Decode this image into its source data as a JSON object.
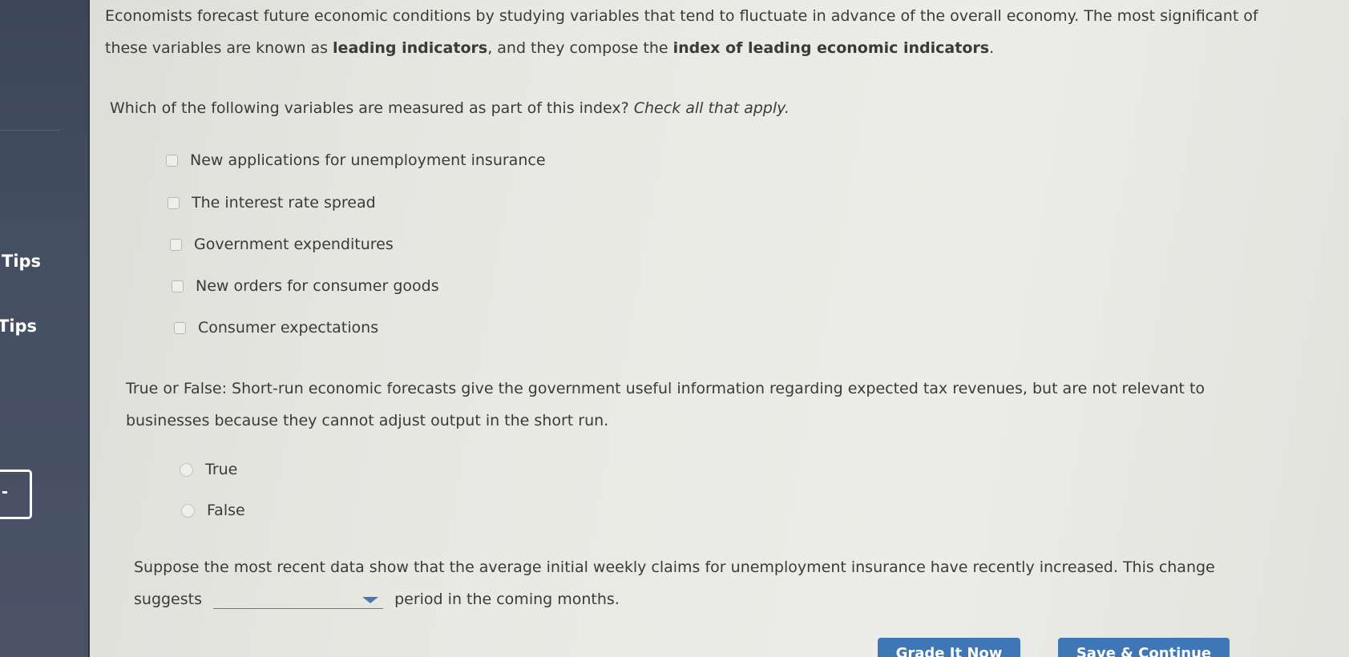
{
  "sidebar": {
    "tips_label_1": "Tips",
    "tips_label_2": "Tips"
  },
  "intro": {
    "part1": "Economists forecast future economic conditions by studying variables that tend to fluctuate in advance of the overall economy. The most significant of these variables are known as ",
    "bold1": "leading indicators",
    "part2": ", and they compose the ",
    "bold2": "index of leading economic indicators",
    "part3": "."
  },
  "question1": {
    "text": "Which of the following variables are measured as part of this index?",
    "instruction": "Check all that apply.",
    "options": [
      "New applications for unemployment insurance",
      "The interest rate spread",
      "Government expenditures",
      "New orders for consumer goods",
      "Consumer expectations"
    ]
  },
  "question2": {
    "text": "True or False: Short-run economic forecasts give the government useful information regarding expected tax revenues, but are not relevant to businesses because they cannot adjust output in the short run.",
    "options": [
      "True",
      "False"
    ]
  },
  "question3": {
    "text_before": "Suppose the most recent data show that the average initial weekly claims for unemployment insurance have recently increased. This change suggests",
    "dropdown_value": "",
    "text_after": "period in the coming months."
  },
  "buttons": {
    "grade_label": "Grade It Now",
    "save_label": "Save & Continue"
  },
  "colors": {
    "sidebar": "#454f62",
    "button": "#3f76b6",
    "dropdown_caret": "#4a77b4"
  }
}
